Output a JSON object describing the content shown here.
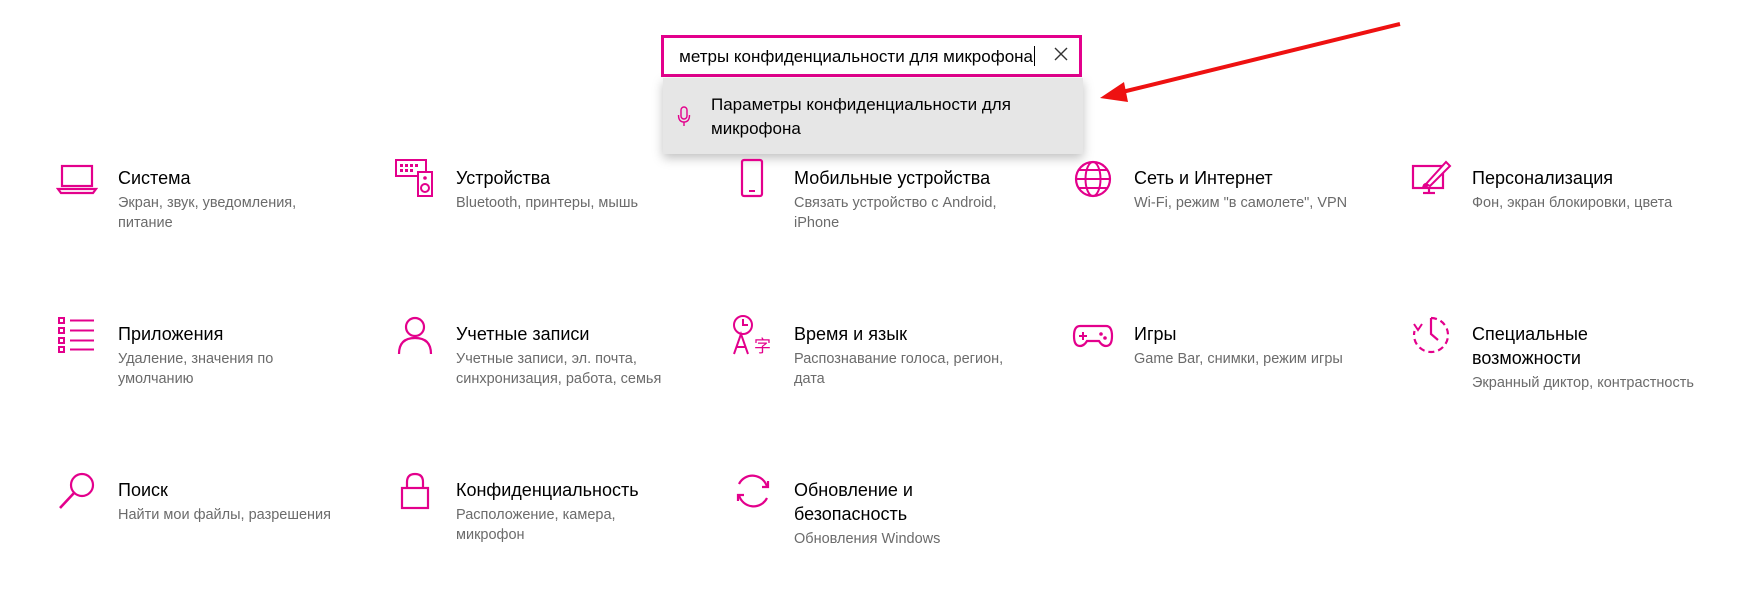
{
  "search": {
    "value": "Параметры конфиденциальности для микрофона",
    "visible_value": "метры конфиденциальности для микрофона"
  },
  "suggestion": {
    "label": "Параметры конфиденциальности для микрофона",
    "icon": "microphone-icon"
  },
  "accent_color": "#e3008c",
  "annotation_color": "#ee1111",
  "tiles": [
    {
      "title": "Система",
      "desc": "Экран, звук, уведомления, питание",
      "icon": "laptop-icon"
    },
    {
      "title": "Устройства",
      "desc": "Bluetooth, принтеры, мышь",
      "icon": "devices-icon"
    },
    {
      "title": "Мобильные устройства",
      "desc": "Связать устройство с Android, iPhone",
      "icon": "phone-icon"
    },
    {
      "title": "Сеть и Интернет",
      "desc": "Wi-Fi, режим \"в самолете\", VPN",
      "icon": "globe-icon"
    },
    {
      "title": "Персонализация",
      "desc": "Фон, экран блокировки, цвета",
      "icon": "personalization-icon"
    },
    {
      "title": "Приложения",
      "desc": "Удаление, значения по умолчанию",
      "icon": "apps-list-icon"
    },
    {
      "title": "Учетные записи",
      "desc": "Учетные записи, эл. почта, синхронизация, работа, семья",
      "icon": "user-icon"
    },
    {
      "title": "Время и язык",
      "desc": "Распознавание голоса, регион, дата",
      "icon": "time-language-icon"
    },
    {
      "title": "Игры",
      "desc": "Game Bar, снимки, режим игры",
      "icon": "gamepad-icon"
    },
    {
      "title": "Специальные возможности",
      "desc": "Экранный диктор, контрастность",
      "icon": "accessibility-icon"
    },
    {
      "title": "Поиск",
      "desc": "Найти мои файлы, разрешения",
      "icon": "search-icon"
    },
    {
      "title": "Конфиденциальность",
      "desc": "Расположение, камера, микрофон",
      "icon": "lock-icon"
    },
    {
      "title": "Обновление и безопасность",
      "desc": "Обновления Windows",
      "icon": "update-icon"
    }
  ]
}
